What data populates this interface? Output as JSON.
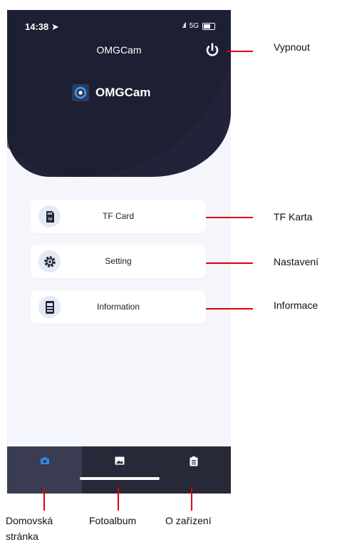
{
  "status_bar": {
    "time": "14:38",
    "network": "5G"
  },
  "header": {
    "title": "OMGCam",
    "logo_text": "OMGCam"
  },
  "menu": [
    {
      "label": "TF Card",
      "icon": "sd-card-icon"
    },
    {
      "label": "Setting",
      "icon": "gear-icon"
    },
    {
      "label": "Information",
      "icon": "device-info-icon"
    }
  ],
  "tabs": [
    {
      "icon": "camera-icon",
      "active": true
    },
    {
      "icon": "image-icon",
      "active": false
    },
    {
      "icon": "clipboard-icon",
      "active": false
    }
  ],
  "annotations": {
    "power": "Vypnout",
    "tf_card": "TF Karta",
    "settings": "Nastavení",
    "information": "Informace",
    "tab_home_line1": "Domovská",
    "tab_home_line2": "stránka",
    "tab_album": "Fotoalbum",
    "tab_device": "O zařízení"
  },
  "colors": {
    "accent": "#2f8de4",
    "callout": "#e00000",
    "header_bg": "#222338"
  }
}
